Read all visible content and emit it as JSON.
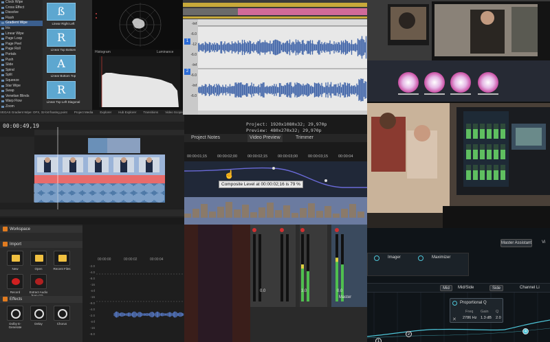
{
  "transitions": {
    "list": [
      "Clock Wipe",
      "Cross Effect",
      "Dissolve",
      "Flash",
      "Gradient Wipe",
      "Iris",
      "Linear Wipe",
      "Page Loop",
      "Page Peel",
      "Page Roll",
      "Portals",
      "Push",
      "Slide",
      "Spiral",
      "Split",
      "Squeeze",
      "Star Wipe",
      "Swap",
      "Venetian Blinds",
      "Warp Flow",
      "Zoom"
    ],
    "selected_index": 4,
    "presets": [
      {
        "glyph": "ß",
        "label": "Linear Right Left"
      },
      {
        "glyph": "R",
        "label": "Linear Top Bottom"
      },
      {
        "glyph": "A",
        "label": "Linear Bottom Top"
      },
      {
        "glyph": "R",
        "label": "Linear Top Left Diagonal"
      }
    ],
    "histogram_label": "Histogram",
    "luminance_label": "Luminance",
    "status_items": [
      "VEGAS Gradient Wipe: OFX, 32-bit floating point",
      "Project Media",
      "Explorer",
      "Hub Explorer",
      "Transitions",
      "Video Scopes"
    ]
  },
  "wave_editor": {
    "track_numbers": [
      "1",
      "2"
    ],
    "db_labels": [
      "-Inf",
      "-6.0",
      "-12",
      "-6.0",
      "-Inf",
      "-6.0",
      "-Inf",
      "-6.0"
    ]
  },
  "timeline": {
    "timecode": "00:00:49,19"
  },
  "composite": {
    "project_line": "Project:  1920x1080x32; 29,970p",
    "preview_line": "Preview:  480x270x32; 29,970p",
    "tabs": [
      "Project Notes",
      "Video Preview",
      "Trimmer"
    ],
    "ruler": [
      "00:00:01;15",
      "00:00:02;00",
      "00:00:02;15",
      "00:00:03;00",
      "00:00:03;15",
      "00:00:04"
    ],
    "tooltip": "Composite Level at 00:00:02;16 is 79 %"
  },
  "workspace": {
    "workspace_label": "Workspace",
    "import_label": "Import",
    "effects_label": "Effects",
    "import_items": [
      "New",
      "Open",
      "Recent Files",
      "Record",
      "Extract Audio from CD..."
    ],
    "effect_items": [
      "Dolby E-Generate",
      "Delay",
      "Chorus"
    ]
  },
  "audio_timeline": {
    "ruler": [
      "00:00:00",
      "00:00:02",
      "00:00:04"
    ],
    "db_scale": [
      "-2.0",
      "-4.0",
      "-8.0",
      "-16",
      "-Inf",
      "-16",
      "-8.0",
      "-4.0",
      "-2.0",
      "-Inf",
      "-16",
      "-8.0"
    ]
  },
  "mixer": {
    "channel_values": [
      "0.0",
      "3.0",
      "0.0"
    ],
    "scale": [
      "6",
      "12",
      "18",
      "24",
      "30",
      "36",
      "42",
      "48"
    ],
    "master_label": "Master"
  },
  "eq": {
    "master_assistant": "Master Assistant",
    "view_label": "Vi",
    "modules": [
      "Imager",
      "Maximizer"
    ],
    "mid_label": "Mid",
    "mode": "Mid/Side",
    "side_label": "Side",
    "channel_label": "Channel Li",
    "band_type": "Proportional Q",
    "freq_label": "Freq",
    "freq_value": "2786 Hz",
    "gain_label": "Gain",
    "gain_value": "1.3 dB",
    "q_label": "Q",
    "q_value": "2.0",
    "nodes": [
      "1",
      "2",
      "4"
    ]
  },
  "colors": {
    "accent_blue": "#2b6bd6",
    "clip_red": "#e06060",
    "waveform_blue": "#3f63a8",
    "eq_cyan": "#4ec6d9"
  }
}
